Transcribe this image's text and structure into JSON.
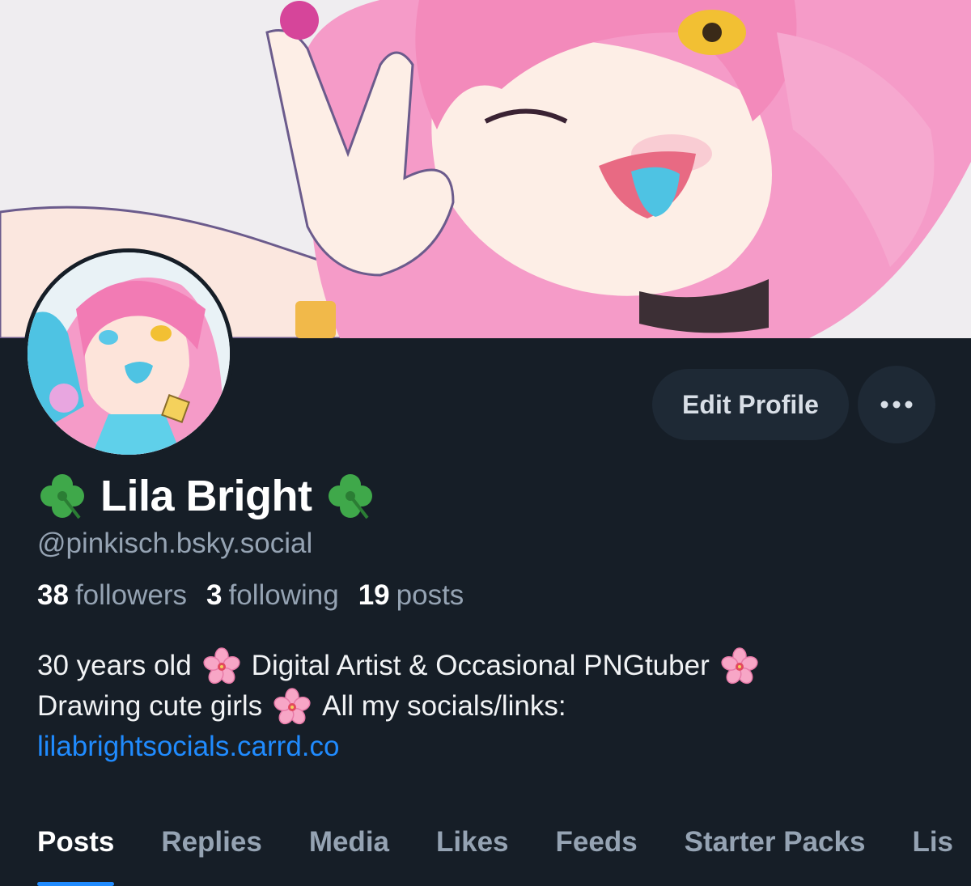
{
  "profile": {
    "display_name": "Lila Bright",
    "name_emoji": "shamrock-icon",
    "handle": "@pinkisch.bsky.social",
    "stats": [
      {
        "count": "38",
        "label": "followers"
      },
      {
        "count": "3",
        "label": "following"
      },
      {
        "count": "19",
        "label": "posts"
      }
    ],
    "bio": {
      "line1_a": "30 years old",
      "line1_b": "Digital Artist & Occasional PNGtuber",
      "line2_a": "Drawing cute girls",
      "line2_b": "All my socials/links:",
      "link": "lilabrightsocials.carrd.co"
    }
  },
  "actions": {
    "edit_profile": "Edit Profile",
    "more_icon": "ellipsis-icon"
  },
  "tabs": [
    "Posts",
    "Replies",
    "Media",
    "Likes",
    "Feeds",
    "Starter Packs",
    "Lis"
  ],
  "active_tab": "Posts",
  "colors": {
    "background": "#161e27",
    "button_bg": "#1e2935",
    "muted_text": "#95a3b3",
    "link": "#208bfe",
    "accent_underline": "#208bfe"
  }
}
